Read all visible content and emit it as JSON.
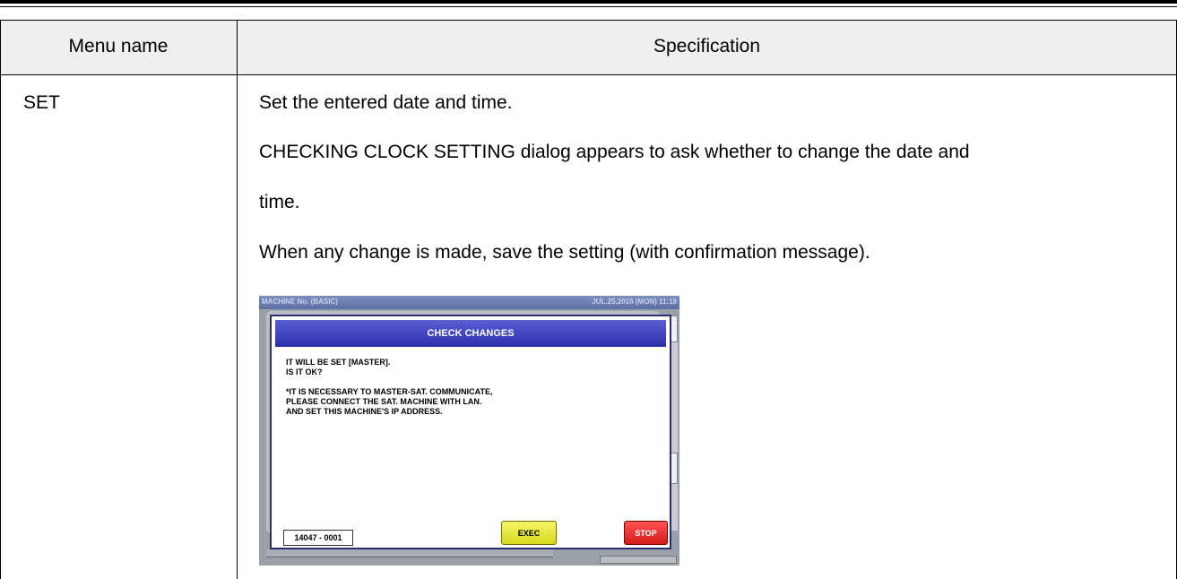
{
  "table": {
    "header": {
      "menu_name": "Menu name",
      "specification": "Specification"
    },
    "rows": [
      {
        "menu_name": "SET",
        "spec_lines": [
          "Set the entered date and time.",
          "CHECKING CLOCK SETTING dialog appears to ask whether to change the date and",
          "time.",
          "When any change is made, save the setting (with confirmation message)."
        ]
      }
    ]
  },
  "screenshot": {
    "topbar_left": "MACHINE No. (BASIC)",
    "topbar_right": "JUL.25.2016 (MON) 11:18",
    "dialog_title": "CHECK CHANGES",
    "lines": [
      "IT WILL BE SET [MASTER].",
      "IS IT OK?",
      "*IT IS NECESSARY TO MASTER-SAT. COMMUNICATE,",
      "PLEASE CONNECT THE SAT. MACHINE WITH LAN.",
      "AND SET THIS MACHINE'S IP ADDRESS."
    ],
    "code": "14047 - 0001",
    "exec_label": "EXEC",
    "stop_label": "STOP"
  }
}
